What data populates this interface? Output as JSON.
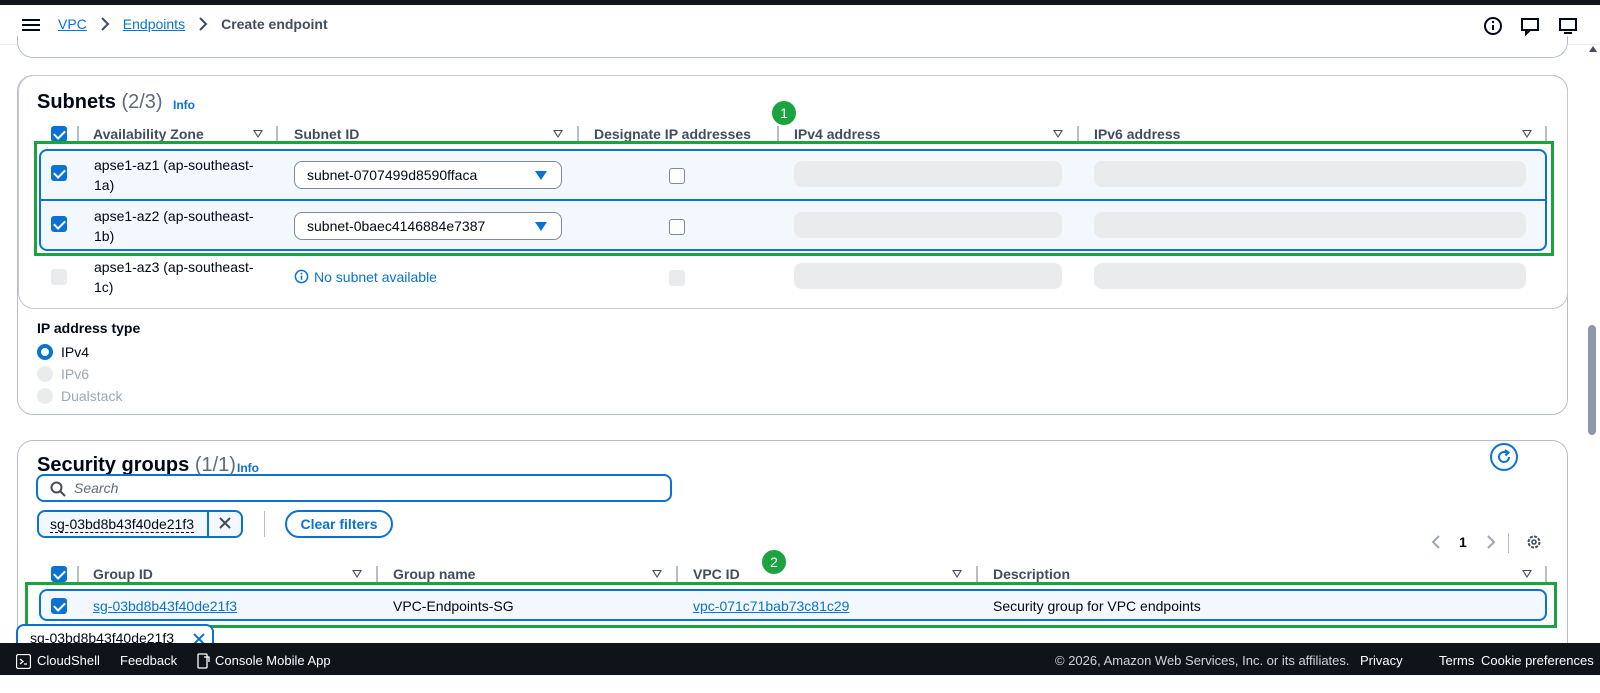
{
  "breadcrumbs": {
    "vpc": "VPC",
    "endpoints": "Endpoints",
    "current": "Create endpoint"
  },
  "subnets": {
    "title": "Subnets",
    "count": "(2/3)",
    "info": "Info",
    "headers": {
      "az": "Availability Zone",
      "subnet_id": "Subnet ID",
      "designate": "Designate IP addresses",
      "ipv4": "IPv4 address",
      "ipv6": "IPv6 address"
    },
    "rows": [
      {
        "az_line1": "apse1-az1 (ap-southeast-",
        "az_line2": "1a)",
        "subnet": "subnet-0707499d8590ffaca",
        "selected": true
      },
      {
        "az_line1": "apse1-az2 (ap-southeast-",
        "az_line2": "1b)",
        "subnet": "subnet-0baec4146884e7387",
        "selected": true
      },
      {
        "az_line1": "apse1-az3 (ap-southeast-",
        "az_line2": "1c)",
        "subnet": "No subnet available",
        "selected": false
      }
    ]
  },
  "ip_type": {
    "label": "IP address type",
    "options": [
      "IPv4",
      "IPv6",
      "Dualstack"
    ],
    "selected": "IPv4"
  },
  "annotations": {
    "badge1": "1",
    "badge2": "2"
  },
  "security_groups": {
    "title": "Security groups",
    "count": "(1/1)",
    "info": "Info",
    "search_placeholder": "Search",
    "filter_token": "sg-03bd8b43f40de21f3",
    "clear_filters": "Clear filters",
    "page": "1",
    "headers": {
      "group_id": "Group ID",
      "group_name": "Group name",
      "vpc_id": "VPC ID",
      "description": "Description"
    },
    "rows": [
      {
        "group_id": "sg-03bd8b43f40de21f3",
        "group_name": "VPC-Endpoints-SG",
        "vpc_id": "vpc-071c71bab73c81c29",
        "description": "Security group for VPC endpoints"
      }
    ]
  },
  "selected_chip": "sg-03bd8b43f40de21f3",
  "footer": {
    "cloudshell": "CloudShell",
    "feedback": "Feedback",
    "mobile_app": "Console Mobile App",
    "copyright": "© 2026, Amazon Web Services, Inc. or its affiliates.",
    "privacy": "Privacy",
    "terms": "Terms",
    "cookies": "Cookie preferences"
  },
  "colors": {
    "accent": "#0972d3",
    "annotation": "#1aa33f",
    "footer_bg": "#0f141a"
  }
}
